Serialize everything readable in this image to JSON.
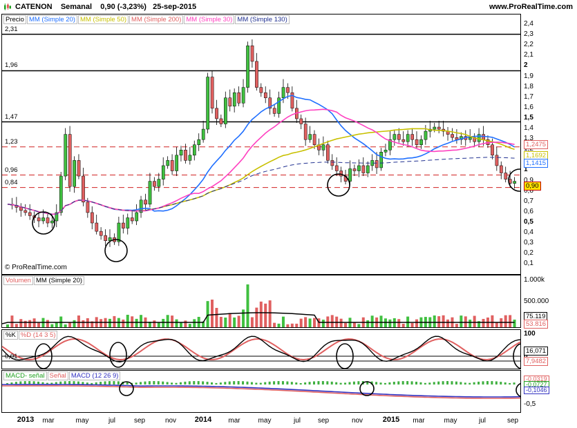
{
  "header": {
    "symbol": "CATENON",
    "period": "Semanal",
    "last": "0,90 (-3,23%)",
    "date": "25-sep-2015",
    "site": "www.ProRealTime.com"
  },
  "copyright": "© ProRealTime.com",
  "price_panel": {
    "legend": [
      {
        "label": "Precio",
        "color": "#000000"
      },
      {
        "label": "MM (Simple 20)",
        "color": "#1f6fff"
      },
      {
        "label": "MM (Simple 50)",
        "color": "#c8c000"
      },
      {
        "label": "MM (Simple 200)",
        "color": "#e06060"
      },
      {
        "label": "MM (Simple 30)",
        "color": "#ff40c0"
      },
      {
        "label": "MM (Simple 130)",
        "color": "#203090"
      }
    ],
    "level_labels": [
      "2,31",
      "1,96",
      "1,47",
      "1,23",
      "0,96",
      "0,84"
    ],
    "axis_ticks": [
      "2,4",
      "2,3",
      "2,2",
      "2,1",
      "2",
      "1,9",
      "1,8",
      "1,7",
      "1,6",
      "1,5",
      "1,4",
      "1,3",
      "1,2",
      "1,1",
      "1",
      "0,9",
      "0,8",
      "0,7",
      "0,6",
      "0,5",
      "0,4",
      "0,3",
      "0,2",
      "0,1"
    ],
    "bold_ticks": [
      "2",
      "1,5",
      "1",
      "0,5"
    ],
    "tags": [
      {
        "text": "1,2475",
        "color": "#e06060"
      },
      {
        "text": "1,1692",
        "color": "#c8c000"
      },
      {
        "text": "1,1415",
        "color": "#1f6fff"
      },
      {
        "text": "0,90",
        "color": "#c00000"
      }
    ]
  },
  "volume_panel": {
    "legend": [
      {
        "label": "Volumen",
        "color": "#e06060"
      },
      {
        "label": "MM (Simple 20)",
        "color": "#000000"
      }
    ],
    "axis_ticks": [
      "1.000k",
      "500.000"
    ],
    "tags": [
      {
        "text": "75.119",
        "color": "#000000"
      },
      {
        "text": "53.816",
        "color": "#e06060"
      }
    ]
  },
  "stoch_panel": {
    "legend": [
      {
        "label": "%K",
        "color": "#000000"
      },
      {
        "label": "%D (14 3 5)",
        "color": "#e06060"
      }
    ],
    "level_label": "0,01",
    "axis_ticks": [
      "100",
      "0"
    ],
    "tags": [
      {
        "text": "16,071",
        "color": "#000000"
      },
      {
        "text": "7,9482",
        "color": "#e06060"
      }
    ]
  },
  "macd_panel": {
    "legend": [
      {
        "label": "MACD- señal",
        "color": "#20a020"
      },
      {
        "label": "Señal",
        "color": "#e06060"
      },
      {
        "label": "MACD (12 26 9)",
        "color": "#3030c0"
      }
    ],
    "axis_ticks": [
      "0",
      "-0,5"
    ],
    "tags": [
      {
        "text": "-0,0319",
        "color": "#e06060"
      },
      {
        "text": "-0,0727",
        "color": "#20a020"
      },
      {
        "text": "-0,1046",
        "color": "#3030c0"
      }
    ]
  },
  "x_axis": [
    "2013",
    "mar",
    "may",
    "jul",
    "sep",
    "nov",
    "2014",
    "mar",
    "may",
    "jul",
    "sep",
    "nov",
    "2015",
    "mar",
    "may",
    "jul",
    "sep"
  ],
  "chart_data": {
    "type": "candlestick",
    "title": "CATENON Semanal 0,90 (-3,23%) 25-sep-2015",
    "ylim": [
      0.05,
      2.42
    ],
    "x_labels": [
      "2013",
      "mar",
      "may",
      "jul",
      "sep",
      "nov",
      "2014",
      "mar",
      "may",
      "jul",
      "sep",
      "nov",
      "2015",
      "mar",
      "may",
      "jul",
      "sep"
    ],
    "horizontal_levels": [
      2.31,
      1.96,
      1.47,
      1.23,
      0.96,
      0.84
    ],
    "closes": [
      0.68,
      0.67,
      0.65,
      0.62,
      0.6,
      0.57,
      0.55,
      0.52,
      0.55,
      0.5,
      0.52,
      0.6,
      0.95,
      1.35,
      0.85,
      1.1,
      0.95,
      0.7,
      0.6,
      0.5,
      0.42,
      0.38,
      0.33,
      0.36,
      0.32,
      0.5,
      0.45,
      0.55,
      0.52,
      0.6,
      0.72,
      0.68,
      0.9,
      0.85,
      0.92,
      1.05,
      1.1,
      1.0,
      1.15,
      1.2,
      1.1,
      1.15,
      1.25,
      1.3,
      1.4,
      1.9,
      1.6,
      1.5,
      1.45,
      1.7,
      1.62,
      1.75,
      1.65,
      1.8,
      2.2,
      2.05,
      1.8,
      1.75,
      1.7,
      1.6,
      1.55,
      1.7,
      1.8,
      1.75,
      1.6,
      1.5,
      1.45,
      1.3,
      1.35,
      1.25,
      1.2,
      1.25,
      1.1,
      1.05,
      1.0,
      0.95,
      0.9,
      1.02,
      1.0,
      1.05,
      0.98,
      1.05,
      1.1,
      1.03,
      1.18,
      1.2,
      1.3,
      1.35,
      1.3,
      1.28,
      1.35,
      1.3,
      1.25,
      1.3,
      1.38,
      1.4,
      1.42,
      1.4,
      1.38,
      1.35,
      1.32,
      1.3,
      1.33,
      1.3,
      1.32,
      1.28,
      1.35,
      1.3,
      1.25,
      1.15,
      1.05,
      0.98,
      0.92,
      0.88,
      0.9
    ]
  }
}
